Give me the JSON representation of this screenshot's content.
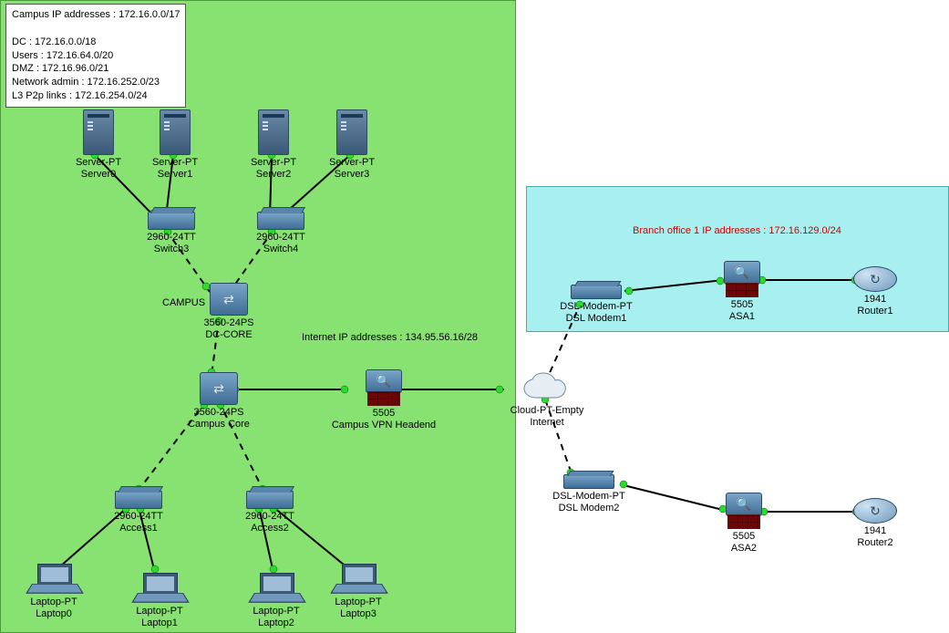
{
  "regions": {
    "campus": {
      "label": "CAMPUS"
    },
    "branch": {
      "label": ""
    }
  },
  "notes": {
    "campus_ip": "Campus IP addresses : 172.16.0.0/17\n\nDC : 172.16.0.0/18\nUsers : 172.16.64.0/20\nDMZ : 172.16.96.0/21\nNetwork admin : 172.16.252.0/23\nL3 P2p links : 172.16.254.0/24"
  },
  "labels": {
    "internet_ip": "Internet IP addresses : 134.95.56.16/28",
    "branch_ip": "Branch office 1 IP addresses : 172.16.129.0/24"
  },
  "devices": {
    "server0": {
      "line1": "Server-PT",
      "line2": "Server0"
    },
    "server1": {
      "line1": "Server-PT",
      "line2": "Server1"
    },
    "server2": {
      "line1": "Server-PT",
      "line2": "Server2"
    },
    "server3": {
      "line1": "Server-PT",
      "line2": "Server3"
    },
    "switch3": {
      "line1": "2960-24TT",
      "line2": "Switch3"
    },
    "switch4": {
      "line1": "2960-24TT",
      "line2": "Switch4"
    },
    "dccore": {
      "line1": "3560-24PS",
      "line2": "DC-CORE"
    },
    "campuscore": {
      "line1": "3560-24PS",
      "line2": "Campus Core"
    },
    "vpnhead": {
      "line1": "5505",
      "line2": "Campus VPN Headend"
    },
    "cloud": {
      "line1": "Cloud-PT-Empty",
      "line2": "Internet"
    },
    "access1": {
      "line1": "2960-24TT",
      "line2": "Access1"
    },
    "access2": {
      "line1": "2960-24TT",
      "line2": "Access2"
    },
    "laptop0": {
      "line1": "Laptop-PT",
      "line2": "Laptop0"
    },
    "laptop1": {
      "line1": "Laptop-PT",
      "line2": "Laptop1"
    },
    "laptop2": {
      "line1": "Laptop-PT",
      "line2": "Laptop2"
    },
    "laptop3": {
      "line1": "Laptop-PT",
      "line2": "Laptop3"
    },
    "modem1": {
      "line1": "DSL-Modem-PT",
      "line2": "DSL Modem1"
    },
    "modem2": {
      "line1": "DSL-Modem-PT",
      "line2": "DSL Modem2"
    },
    "asa1": {
      "line1": "5505",
      "line2": "ASA1"
    },
    "asa2": {
      "line1": "5505",
      "line2": "ASA2"
    },
    "router1": {
      "line1": "1941",
      "line2": "Router1"
    },
    "router2": {
      "line1": "1941",
      "line2": "Router2"
    }
  },
  "chart_data": {
    "type": "diagram",
    "title": "Packet Tracer network topology — Campus, Internet, and Branch Office 1",
    "address_blocks": {
      "Campus": "172.16.0.0/17",
      "DC": "172.16.0.0/18",
      "Users": "172.16.64.0/20",
      "DMZ": "172.16.96.0/21",
      "Network admin": "172.16.252.0/23",
      "L3 P2p links": "172.16.254.0/24",
      "Internet": "134.95.56.16/28",
      "Branch office 1": "172.16.129.0/24"
    },
    "zones": [
      {
        "id": "campus",
        "label": "CAMPUS",
        "color": "green",
        "members": [
          "server0",
          "server1",
          "server2",
          "server3",
          "switch3",
          "switch4",
          "dccore",
          "campuscore",
          "vpnhead",
          "access1",
          "access2",
          "laptop0",
          "laptop1",
          "laptop2",
          "laptop3"
        ]
      },
      {
        "id": "branch1",
        "label": "Branch office 1",
        "color": "cyan",
        "members": [
          "modem1",
          "asa1",
          "router1"
        ]
      }
    ],
    "nodes": [
      {
        "id": "server0",
        "type": "server",
        "model": "Server-PT",
        "name": "Server0"
      },
      {
        "id": "server1",
        "type": "server",
        "model": "Server-PT",
        "name": "Server1"
      },
      {
        "id": "server2",
        "type": "server",
        "model": "Server-PT",
        "name": "Server2"
      },
      {
        "id": "server3",
        "type": "server",
        "model": "Server-PT",
        "name": "Server3"
      },
      {
        "id": "switch3",
        "type": "switch",
        "model": "2960-24TT",
        "name": "Switch3"
      },
      {
        "id": "switch4",
        "type": "switch",
        "model": "2960-24TT",
        "name": "Switch4"
      },
      {
        "id": "dccore",
        "type": "l3-switch",
        "model": "3560-24PS",
        "name": "DC-CORE"
      },
      {
        "id": "campuscore",
        "type": "l3-switch",
        "model": "3560-24PS",
        "name": "Campus Core"
      },
      {
        "id": "vpnhead",
        "type": "firewall",
        "model": "5505",
        "name": "Campus VPN Headend"
      },
      {
        "id": "cloud",
        "type": "cloud",
        "model": "Cloud-PT-Empty",
        "name": "Internet"
      },
      {
        "id": "access1",
        "type": "switch",
        "model": "2960-24TT",
        "name": "Access1"
      },
      {
        "id": "access2",
        "type": "switch",
        "model": "2960-24TT",
        "name": "Access2"
      },
      {
        "id": "laptop0",
        "type": "laptop",
        "model": "Laptop-PT",
        "name": "Laptop0"
      },
      {
        "id": "laptop1",
        "type": "laptop",
        "model": "Laptop-PT",
        "name": "Laptop1"
      },
      {
        "id": "laptop2",
        "type": "laptop",
        "model": "Laptop-PT",
        "name": "Laptop2"
      },
      {
        "id": "laptop3",
        "type": "laptop",
        "model": "Laptop-PT",
        "name": "Laptop3"
      },
      {
        "id": "modem1",
        "type": "dsl-modem",
        "model": "DSL-Modem-PT",
        "name": "DSL Modem1"
      },
      {
        "id": "modem2",
        "type": "dsl-modem",
        "model": "DSL-Modem-PT",
        "name": "DSL Modem2"
      },
      {
        "id": "asa1",
        "type": "firewall",
        "model": "5505",
        "name": "ASA1"
      },
      {
        "id": "asa2",
        "type": "firewall",
        "model": "5505",
        "name": "ASA2"
      },
      {
        "id": "router1",
        "type": "router",
        "model": "1941",
        "name": "Router1"
      },
      {
        "id": "router2",
        "type": "router",
        "model": "1941",
        "name": "Router2"
      }
    ],
    "links": [
      {
        "a": "server0",
        "b": "switch3",
        "style": "solid",
        "status": [
          "up",
          "up"
        ]
      },
      {
        "a": "server1",
        "b": "switch3",
        "style": "solid",
        "status": [
          "up",
          "up"
        ]
      },
      {
        "a": "server2",
        "b": "switch4",
        "style": "solid",
        "status": [
          "up",
          "up"
        ]
      },
      {
        "a": "server3",
        "b": "switch4",
        "style": "solid",
        "status": [
          "up",
          "up"
        ]
      },
      {
        "a": "switch3",
        "b": "dccore",
        "style": "dashed",
        "status": [
          "up",
          "up"
        ]
      },
      {
        "a": "switch4",
        "b": "dccore",
        "style": "dashed",
        "status": [
          "up",
          "up"
        ]
      },
      {
        "a": "dccore",
        "b": "campuscore",
        "style": "dashed",
        "status": [
          "up",
          "up"
        ]
      },
      {
        "a": "campuscore",
        "b": "access1",
        "style": "dashed",
        "status": [
          "up",
          "up"
        ]
      },
      {
        "a": "campuscore",
        "b": "access2",
        "style": "dashed",
        "status": [
          "up",
          "up"
        ]
      },
      {
        "a": "campuscore",
        "b": "vpnhead",
        "style": "solid",
        "status": [
          "up",
          "up"
        ]
      },
      {
        "a": "vpnhead",
        "b": "cloud",
        "style": "solid",
        "status": [
          "up",
          "up"
        ]
      },
      {
        "a": "access1",
        "b": "laptop0",
        "style": "solid",
        "status": [
          "up",
          "up"
        ]
      },
      {
        "a": "access1",
        "b": "laptop1",
        "style": "solid",
        "status": [
          "up",
          "up"
        ]
      },
      {
        "a": "access2",
        "b": "laptop2",
        "style": "solid",
        "status": [
          "up",
          "up"
        ]
      },
      {
        "a": "access2",
        "b": "laptop3",
        "style": "solid",
        "status": [
          "up",
          "up"
        ]
      },
      {
        "a": "cloud",
        "b": "modem1",
        "style": "dashed",
        "status": [
          "up",
          "up"
        ]
      },
      {
        "a": "cloud",
        "b": "modem2",
        "style": "dashed",
        "status": [
          "up",
          "up"
        ]
      },
      {
        "a": "modem1",
        "b": "asa1",
        "style": "solid",
        "status": [
          "up",
          "up"
        ]
      },
      {
        "a": "asa1",
        "b": "router1",
        "style": "solid",
        "status": [
          "up",
          "up"
        ]
      },
      {
        "a": "modem2",
        "b": "asa2",
        "style": "solid",
        "status": [
          "up",
          "up"
        ]
      },
      {
        "a": "asa2",
        "b": "router2",
        "style": "solid",
        "status": [
          "up",
          "up"
        ]
      }
    ]
  }
}
